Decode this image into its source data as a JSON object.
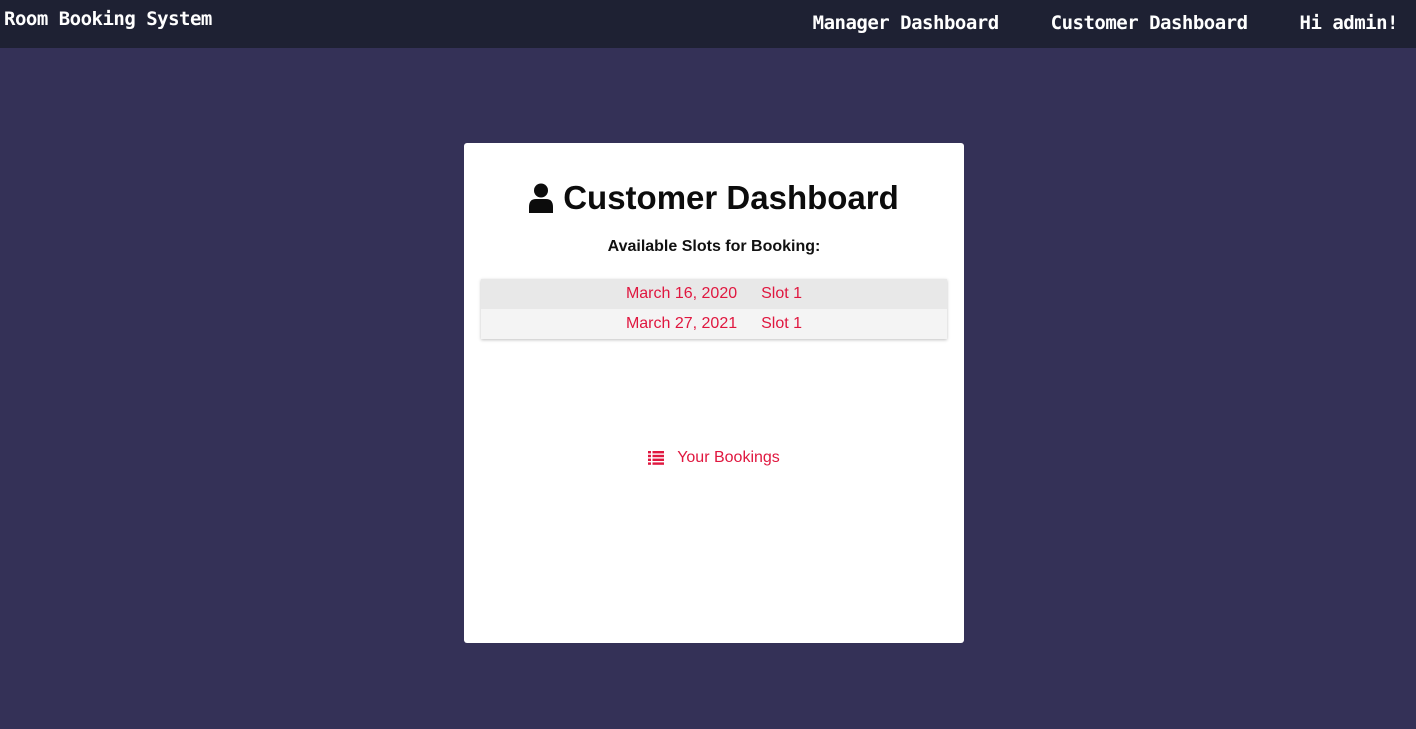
{
  "navbar": {
    "brand": "Room Booking System",
    "links": [
      "Manager Dashboard",
      "Customer Dashboard",
      "Hi admin!"
    ]
  },
  "card": {
    "title": "Customer Dashboard",
    "title_icon": "user-icon",
    "subtitle": "Available Slots for Booking:",
    "slots": [
      {
        "date": "March 16, 2020",
        "slot": "Slot 1"
      },
      {
        "date": "March 27, 2021",
        "slot": "Slot 1"
      }
    ],
    "bookings_link": "Your Bookings",
    "bookings_icon": "list-icon"
  },
  "colors": {
    "background": "#343157",
    "navbar": "#1e2133",
    "accent": "#e0173f"
  }
}
